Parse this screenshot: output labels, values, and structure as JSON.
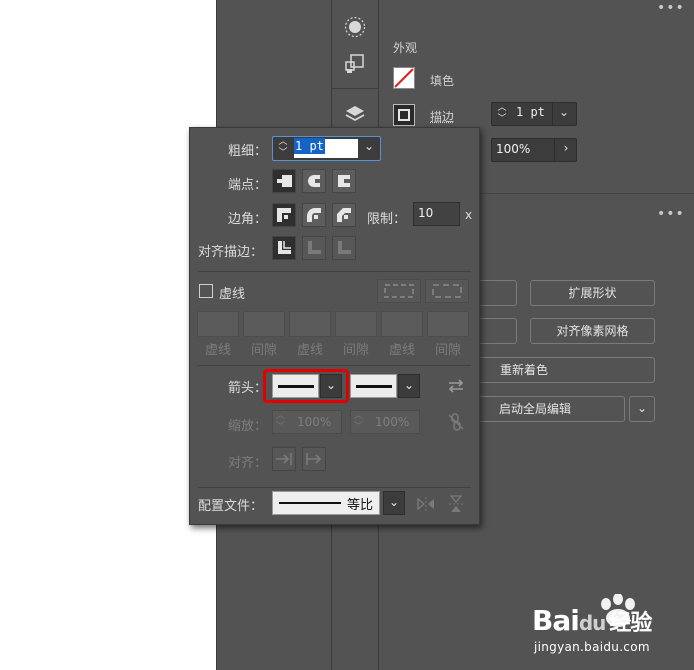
{
  "colors": {
    "panel_bg": "#535353",
    "highlight_red": "#e00000",
    "selection_blue": "#1464c8"
  },
  "main_panel": {
    "appearance_label": "外观",
    "fill_label": "填色",
    "stroke_label": "描边",
    "stroke_value": "1 pt",
    "opacity_value": "100%",
    "buttons": {
      "expand_shape": "扩展形状",
      "align_pixel_grid": "对齐像素网格",
      "recolor": "重新着色",
      "global_edit": "启动全局编辑"
    }
  },
  "stroke_popup": {
    "weight_label": "粗细：",
    "weight_value": "1 pt",
    "cap_label": "端点：",
    "corner_label": "边角：",
    "limit_label": "限制：",
    "limit_value": "10",
    "limit_unit": "x",
    "align_label": "对齐描边：",
    "dashed_label": "虚线",
    "dash_headers": [
      "虚线",
      "间隙",
      "虚线",
      "间隙",
      "虚线",
      "间隙"
    ],
    "arrowhead_label": "箭头：",
    "scale_label": "缩放：",
    "scale_start": "100%",
    "scale_end": "100%",
    "align_arrow_label": "对齐：",
    "profile_label": "配置文件：",
    "profile_value": "等比"
  },
  "watermark": {
    "brand": "Bai",
    "brand_mid": "du",
    "suffix": "经验",
    "url": "jingyan.baidu.com"
  }
}
